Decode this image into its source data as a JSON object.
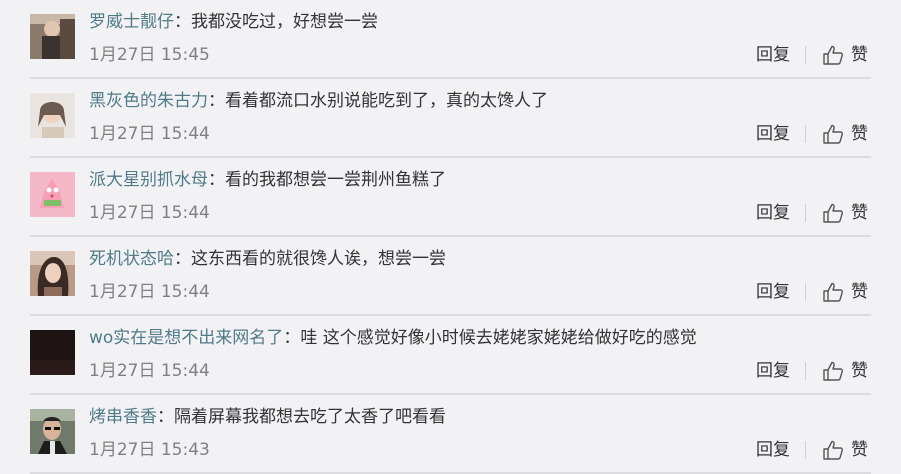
{
  "comments": [
    {
      "username": "罗威士靓仔",
      "colon": "：",
      "text": "我都没吃过，好想尝一尝",
      "time": "1月27日 15:45"
    },
    {
      "username": "黑灰色的朱古力",
      "colon": "：",
      "text": "看着都流口水别说能吃到了，真的太馋人了",
      "time": "1月27日 15:44"
    },
    {
      "username": "派大星别抓水母",
      "colon": "：",
      "text": "看的我都想尝一尝荆州鱼糕了",
      "time": "1月27日 15:44"
    },
    {
      "username": "死机状态哈",
      "colon": "：",
      "text": "这东西看的就很馋人诶，想尝一尝",
      "time": "1月27日 15:44"
    },
    {
      "username": "wo实在是想不出来网名了",
      "colon": "：",
      "text": "哇 这个感觉好像小时候去姥姥家姥姥给做好吃的感觉",
      "time": "1月27日 15:44"
    },
    {
      "username": "烤串香香",
      "colon": "：",
      "text": "隔着屏幕我都想去吃了太香了吧看看",
      "time": "1月27日 15:43"
    }
  ],
  "actions": {
    "reply_label": "回复",
    "like_label": "赞"
  },
  "colors": {
    "username": "#507a86",
    "text": "#333333",
    "time": "#808080",
    "background": "#f2f2f5"
  }
}
